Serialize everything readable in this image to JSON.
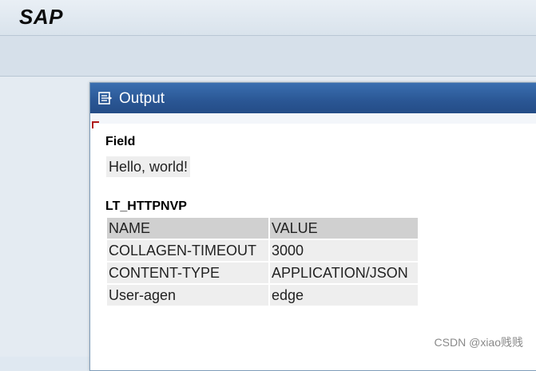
{
  "app": {
    "title": "SAP"
  },
  "dialog": {
    "title": "Output",
    "icon": "output-list-icon",
    "field_label": "Field",
    "field_value": "Hello, world!",
    "table_label": "LT_HTTPNVP",
    "table": {
      "columns": [
        "NAME",
        "VALUE"
      ],
      "rows": [
        [
          "COLLAGEN-TIMEOUT",
          "3000"
        ],
        [
          "CONTENT-TYPE",
          "APPLICATION/JSON"
        ],
        [
          "User-agen",
          "edge"
        ]
      ]
    }
  },
  "watermark": "CSDN @xiao贱贱"
}
